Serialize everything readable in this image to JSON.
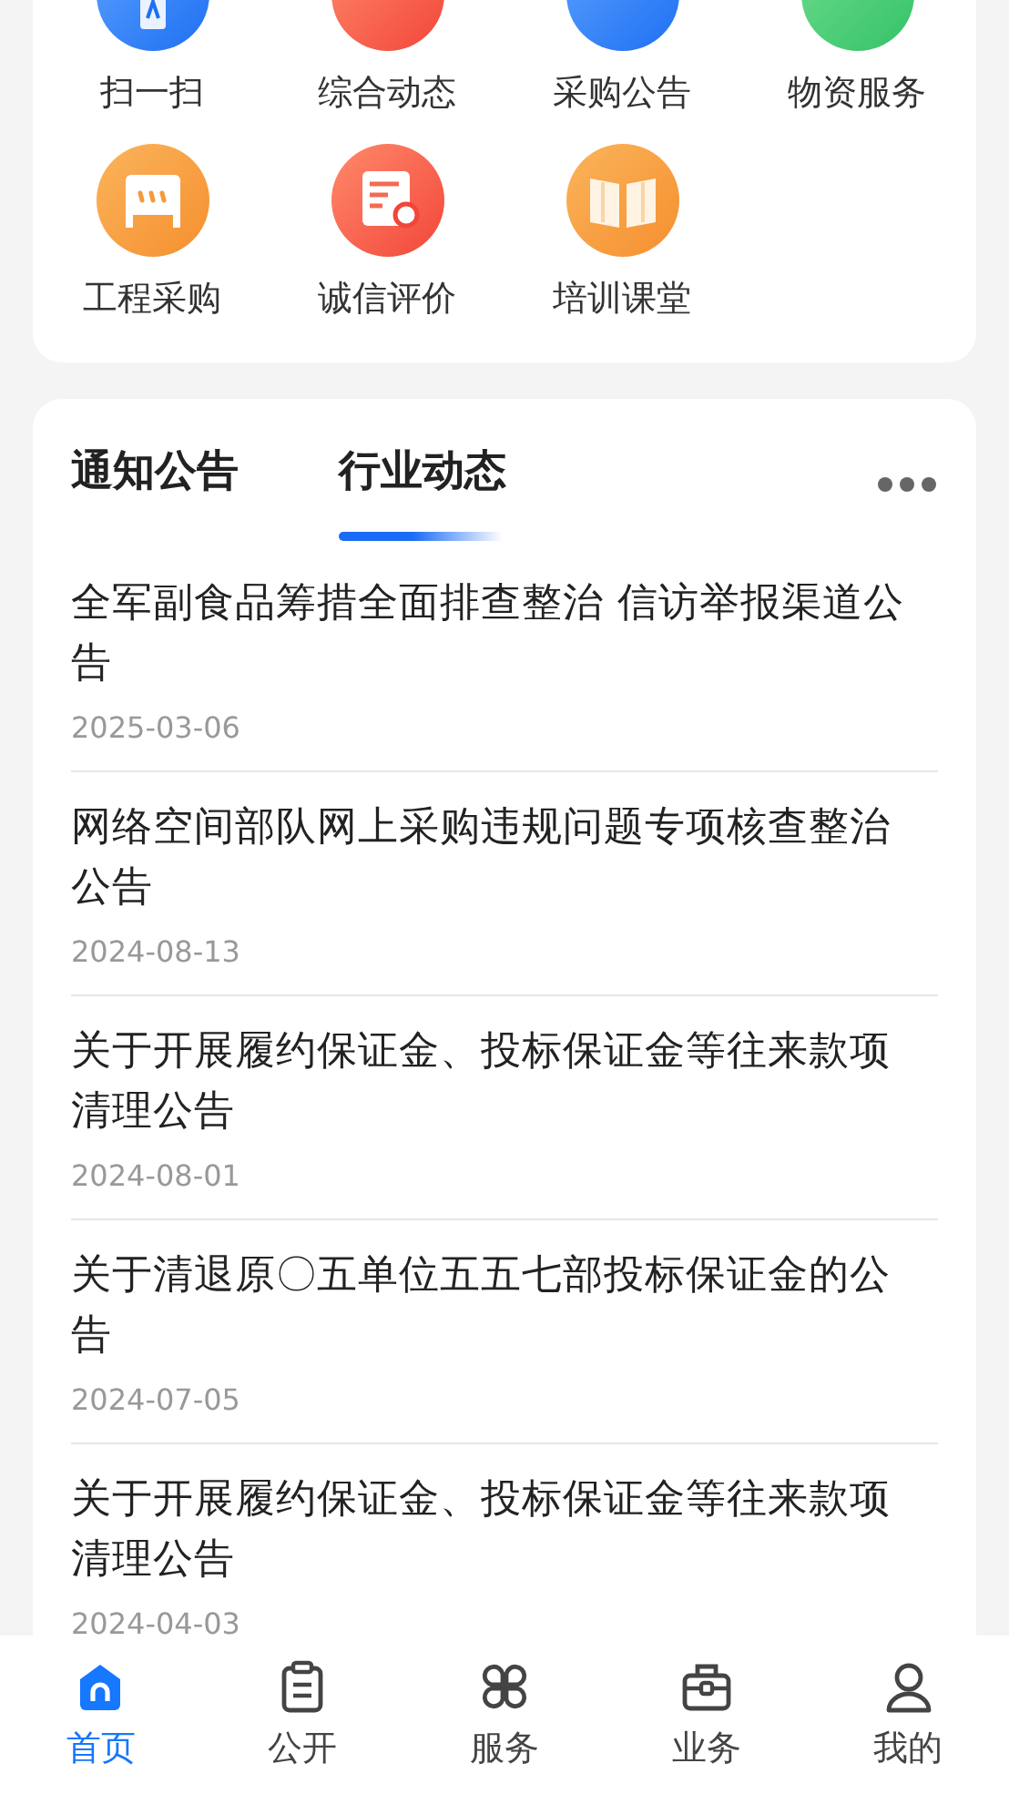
{
  "shortcuts": [
    {
      "label": "扫一扫"
    },
    {
      "label": "综合动态"
    },
    {
      "label": "采购公告"
    },
    {
      "label": "物资服务"
    },
    {
      "label": "工程采购"
    },
    {
      "label": "诚信评价"
    },
    {
      "label": "培训课堂"
    }
  ],
  "news": {
    "tabs": [
      {
        "label": "通知公告",
        "selected": false
      },
      {
        "label": "行业动态",
        "selected": true
      }
    ],
    "items": [
      {
        "title": "全军副食品筹措全面排查整治 信访举报渠道公告",
        "date": "2025-03-06"
      },
      {
        "title": "网络空间部队网上采购违规问题专项核查整治公告",
        "date": "2024-08-13"
      },
      {
        "title": "关于开展履约保证金、投标保证金等往来款项清理公告",
        "date": "2024-08-01"
      },
      {
        "title": "关于清退原〇五单位五五七部投标保证金的公告",
        "date": "2024-07-05"
      },
      {
        "title": "关于开展履约保证金、投标保证金等往来款项清理公告",
        "date": "2024-04-03"
      }
    ]
  },
  "tab_bar": [
    {
      "label": "首页",
      "selected": true
    },
    {
      "label": "公开",
      "selected": false
    },
    {
      "label": "服务",
      "selected": false
    },
    {
      "label": "业务",
      "selected": false
    },
    {
      "label": "我的",
      "selected": false
    }
  ]
}
